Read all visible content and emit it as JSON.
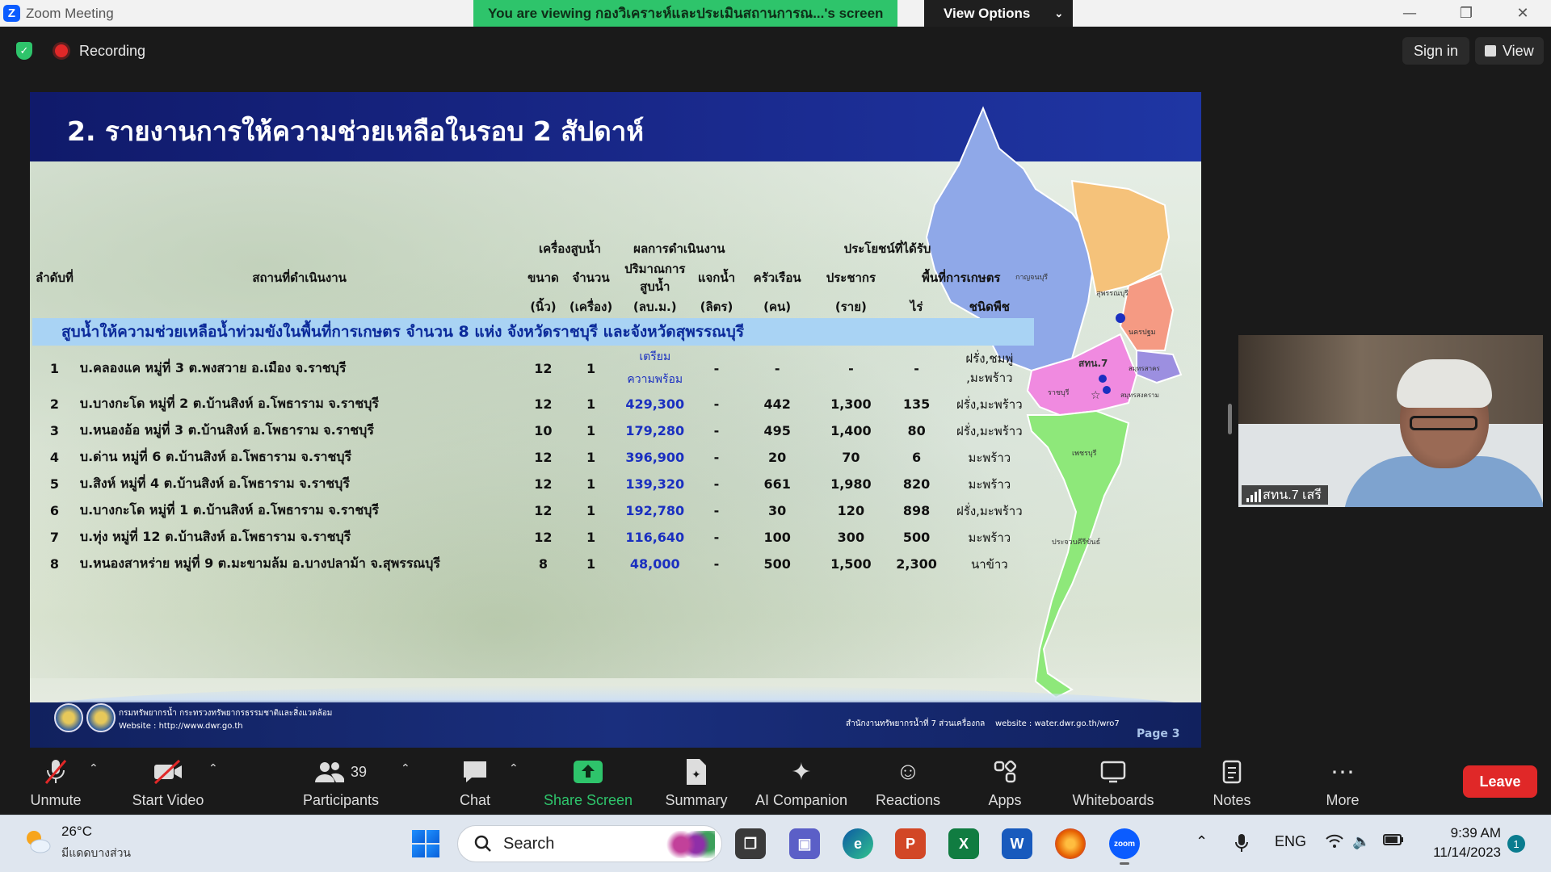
{
  "window": {
    "title": "Zoom Meeting",
    "viewing_banner": "You are viewing กองวิเคราะห์และประเมินสถานการณ...'s screen",
    "view_options": "View Options"
  },
  "meeting_top": {
    "recording_label": "Recording",
    "sign_in": "Sign in",
    "view": "View"
  },
  "slide": {
    "title": "2. รายงานการให้ความช่วยเหลือในรอบ 2 สัปดาห์",
    "headers": {
      "order": "ลำดับที่",
      "place": "สถานที่ดำเนินงาน",
      "pump_group": "เครื่องสูบน้ำ",
      "result_group": "ผลการดำเนินงาน",
      "benefit_group": "ประโยชน์ที่ได้รับ",
      "size": "ขนาด",
      "size_unit": "(นิ้ว)",
      "count": "จำนวน",
      "count_unit": "(เครื่อง)",
      "volume": "ปริมาณการสูบน้ำ",
      "volume_unit": "(ลบ.ม.)",
      "water": "แจกน้ำ",
      "water_unit": "(ลิตร)",
      "households": "ครัวเรือน",
      "households_unit": "(คน)",
      "population": "ประชากร",
      "population_unit": "(ราย)",
      "area": "พื้นที่การเกษตร",
      "rai": "ไร่",
      "crop": "ชนิดพืช"
    },
    "banner": "สูบน้ำให้ความช่วยเหลือน้ำท่วมขังในพื้นที่การเกษตร จำนวน 8 แห่ง จังหวัดราชบุรี และจังหวัดสุพรรณบุรี",
    "rows": [
      {
        "no": "1",
        "place": "บ.คลองแค หมู่ที่ 3 ต.พงสวาย อ.เมือง จ.ราชบุรี",
        "size": "12",
        "count": "1",
        "volume": "เตรียม",
        "volume2": "ความพร้อม",
        "water": "-",
        "households": "-",
        "population": "-",
        "rai": "-",
        "crop": "ฝรั่ง,ชมพู่",
        "crop2": ",มะพร้าว"
      },
      {
        "no": "2",
        "place": "บ.บางกะโด หมู่ที่ 2 ต.บ้านสิงห์ อ.โพธาราม จ.ราชบุรี",
        "size": "12",
        "count": "1",
        "volume": "429,300",
        "water": "-",
        "households": "442",
        "population": "1,300",
        "rai": "135",
        "crop": "ฝรั่ง,มะพร้าว"
      },
      {
        "no": "3",
        "place": "บ.หนองอ้อ หมู่ที่ 3 ต.บ้านสิงห์ อ.โพธาราม จ.ราชบุรี",
        "size": "10",
        "count": "1",
        "volume": "179,280",
        "water": "-",
        "households": "495",
        "population": "1,400",
        "rai": "80",
        "crop": "ฝรั่ง,มะพร้าว"
      },
      {
        "no": "4",
        "place": "บ.ด่าน หมู่ที่ 6 ต.บ้านสิงห์ อ.โพธาราม จ.ราชบุรี",
        "size": "12",
        "count": "1",
        "volume": "396,900",
        "water": "-",
        "households": "20",
        "population": "70",
        "rai": "6",
        "crop": "มะพร้าว"
      },
      {
        "no": "5",
        "place": "บ.สิงห์ หมู่ที่ 4 ต.บ้านสิงห์ อ.โพธาราม จ.ราชบุรี",
        "size": "12",
        "count": "1",
        "volume": "139,320",
        "water": "-",
        "households": "661",
        "population": "1,980",
        "rai": "820",
        "crop": "มะพร้าว"
      },
      {
        "no": "6",
        "place": "บ.บางกะโด หมู่ที่ 1 ต.บ้านสิงห์ อ.โพธาราม จ.ราชบุรี",
        "size": "12",
        "count": "1",
        "volume": "192,780",
        "water": "-",
        "households": "30",
        "population": "120",
        "rai": "898",
        "crop": "ฝรั่ง,มะพร้าว"
      },
      {
        "no": "7",
        "place": "บ.ทุ่ง หมู่ที่ 12 ต.บ้านสิงห์ อ.โพธาราม จ.ราชบุรี",
        "size": "12",
        "count": "1",
        "volume": "116,640",
        "water": "-",
        "households": "100",
        "population": "300",
        "rai": "500",
        "crop": "มะพร้าว"
      },
      {
        "no": "8",
        "place": "บ.หนองสาหร่าย หมู่ที่ 9 ต.มะขามล้ม อ.บางปลาม้า จ.สุพรรณบุรี",
        "size": "8",
        "count": "1",
        "volume": "48,000",
        "water": "-",
        "households": "500",
        "population": "1,500",
        "rai": "2,300",
        "crop": "นาข้าว"
      }
    ],
    "map_labels": [
      "กาญจนบุรี",
      "สุพรรณบุรี",
      "นครปฐม",
      "สทน.7",
      "ราชบุรี",
      "สมุทรสาคร",
      "สมุทรสงคราม",
      "เพชรบุรี",
      "ประจวบคีรีขันธ์"
    ],
    "footer_left_1": "กรมทรัพยากรน้ำ กระทรวงทรัพยากรธรรมชาติและสิ่งแวดล้อม",
    "footer_left_2": "Website : http://www.dwr.go.th",
    "footer_right": "สำนักงานทรัพยากรน้ำที่ 7 ส่วนเครื่องกล",
    "footer_website": "website : water.dwr.go.th/wro7",
    "page": "Page 3"
  },
  "self_view": {
    "name": "สทน.7 เสรี"
  },
  "toolbar": {
    "unmute": "Unmute",
    "start_video": "Start Video",
    "participants": "Participants",
    "participants_count": "39",
    "chat": "Chat",
    "share_screen": "Share Screen",
    "summary": "Summary",
    "ai_companion": "AI Companion",
    "reactions": "Reactions",
    "apps": "Apps",
    "whiteboards": "Whiteboards",
    "notes": "Notes",
    "more": "More",
    "leave": "Leave"
  },
  "taskbar": {
    "temperature": "26°C",
    "condition": "มีแดดบางส่วน",
    "search_placeholder": "Search",
    "language": "ENG",
    "time": "9:39 AM",
    "date": "11/14/2023",
    "notification_count": "1"
  },
  "colors": {
    "zoom_blue": "#0b5cff",
    "banner_green": "#2ec46b",
    "leave_red": "#e02828",
    "slide_header": "#101a6a",
    "table_banner": "#a9d3f4"
  }
}
